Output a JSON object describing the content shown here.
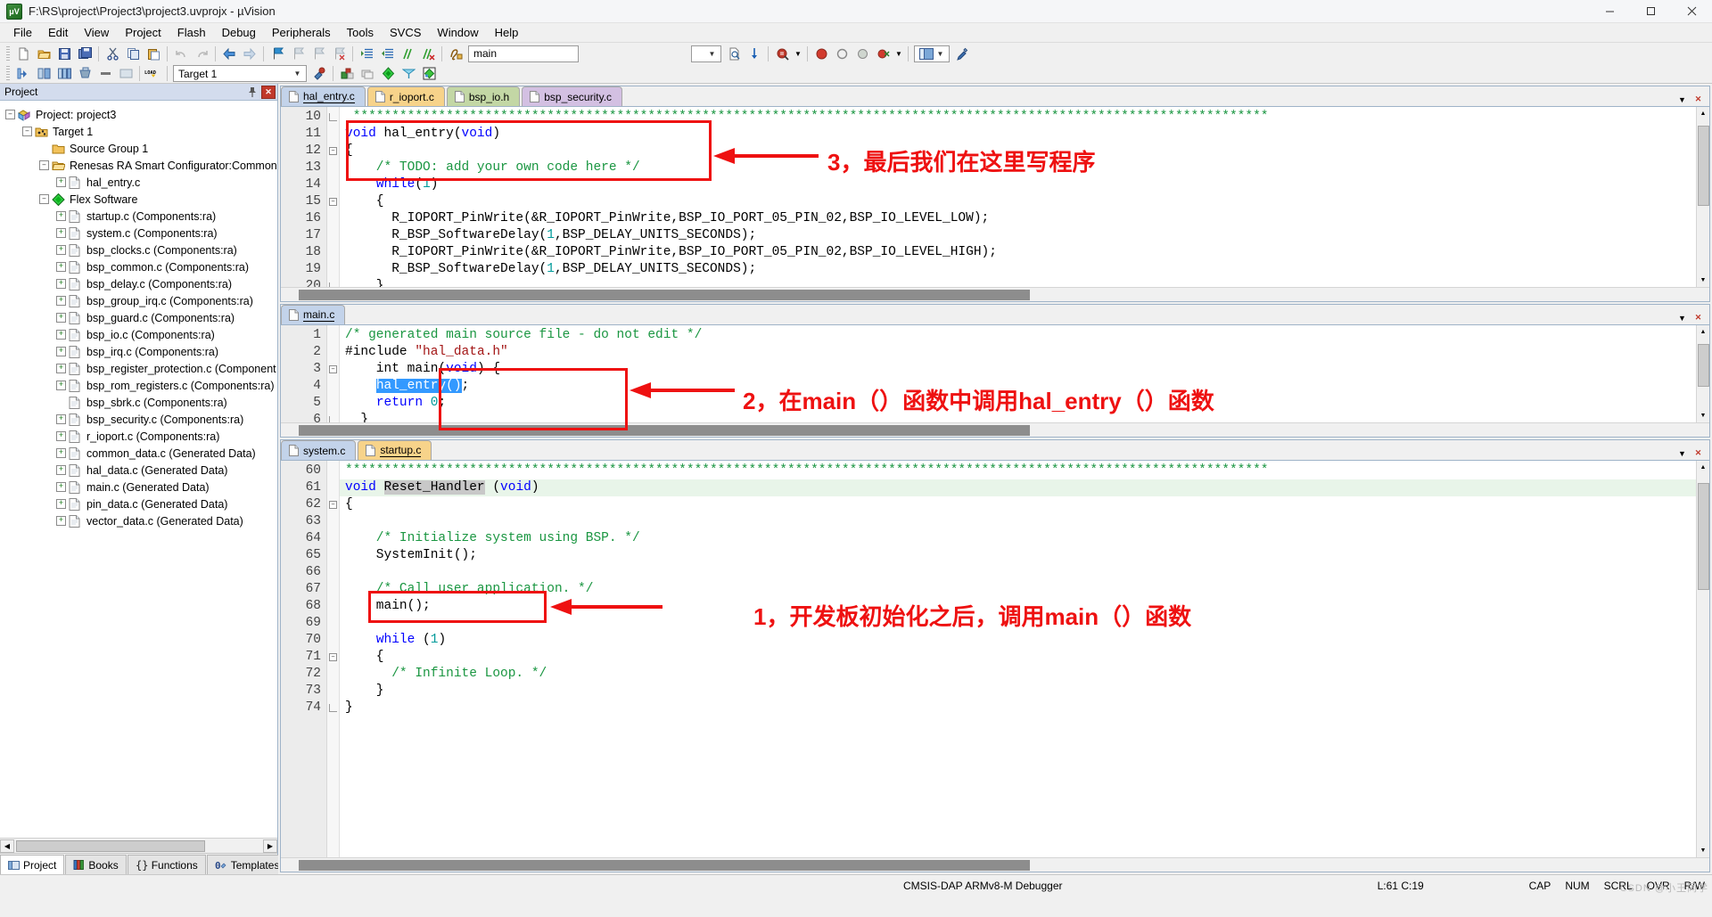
{
  "window": {
    "title": "F:\\RS\\project\\Project3\\project3.uvprojx - µVision",
    "app_icon": "uvision-icon",
    "minimize": "–",
    "maximize": "❐",
    "close": "✕"
  },
  "menu": [
    {
      "label": "File",
      "accel": "F"
    },
    {
      "label": "Edit",
      "accel": "E"
    },
    {
      "label": "View",
      "accel": "V"
    },
    {
      "label": "Project",
      "accel": "P"
    },
    {
      "label": "Flash",
      "accel": "a"
    },
    {
      "label": "Debug",
      "accel": "D"
    },
    {
      "label": "Peripherals",
      "accel": "i"
    },
    {
      "label": "Tools",
      "accel": "T"
    },
    {
      "label": "SVCS",
      "accel": "S"
    },
    {
      "label": "Window",
      "accel": "W"
    },
    {
      "label": "Help",
      "accel": "H"
    }
  ],
  "toolbar_main": {
    "function_combo_value": "main",
    "icons": [
      "new-file-icon",
      "open-file-icon",
      "save-icon",
      "save-all-icon",
      "cut-icon",
      "copy-icon",
      "paste-icon",
      "undo-icon",
      "redo-icon",
      "navigate-back-icon",
      "navigate-forward-icon",
      "bookmark-toggle-icon",
      "bookmark-prev-icon",
      "bookmark-next-icon",
      "bookmark-clear-icon",
      "indent-right-icon",
      "indent-left-icon",
      "comment-icon",
      "uncomment-icon",
      "insert-function-icon",
      "empty-combo",
      "file-find-icon",
      "spell-icon",
      "search-icon",
      "dropdown-arrow-icon",
      "stop-record-icon",
      "start-debug-icon",
      "breakpoint-icon",
      "disable-breakpoint-icon",
      "kill-breakpoints-icon",
      "dropdown-arrow2-icon",
      "window-layout-icon",
      "configure-icon"
    ]
  },
  "toolbar_build": {
    "target_combo_value": "Target 1",
    "icons": [
      "translate-icon",
      "build-icon",
      "rebuild-icon",
      "batch-build-icon",
      "stop-build-icon",
      "load-icon",
      "target-options-icon",
      "manage-runtime-icon",
      "packs-icon",
      "pack-installer-icon",
      "configure-flash-icon",
      "smart-configurator-icon",
      "rte-icon"
    ]
  },
  "project_panel": {
    "title": "Project",
    "pin_icon": "pin-icon",
    "close_icon": "close-icon",
    "tree": [
      {
        "label": "Project: project3",
        "depth": 0,
        "toggle": "minus",
        "icon": "project-icon"
      },
      {
        "label": "Target 1",
        "depth": 1,
        "toggle": "minus",
        "icon": "target-icon"
      },
      {
        "label": "Source Group 1",
        "depth": 2,
        "toggle": "none",
        "icon": "folder-icon"
      },
      {
        "label": "Renesas RA Smart Configurator:Common",
        "depth": 2,
        "toggle": "minus",
        "icon": "folder-open-icon"
      },
      {
        "label": "hal_entry.c",
        "depth": 3,
        "toggle": "plus",
        "icon": "c-file-icon"
      },
      {
        "label": "Flex Software",
        "depth": 2,
        "toggle": "minus",
        "icon": "component-icon"
      },
      {
        "label": "startup.c (Components:ra)",
        "depth": 3,
        "toggle": "plus",
        "icon": "c-file-icon"
      },
      {
        "label": "system.c (Components:ra)",
        "depth": 3,
        "toggle": "plus",
        "icon": "c-file-icon"
      },
      {
        "label": "bsp_clocks.c (Components:ra)",
        "depth": 3,
        "toggle": "plus",
        "icon": "c-file-icon"
      },
      {
        "label": "bsp_common.c (Components:ra)",
        "depth": 3,
        "toggle": "plus",
        "icon": "c-file-icon"
      },
      {
        "label": "bsp_delay.c (Components:ra)",
        "depth": 3,
        "toggle": "plus",
        "icon": "c-file-icon"
      },
      {
        "label": "bsp_group_irq.c (Components:ra)",
        "depth": 3,
        "toggle": "plus",
        "icon": "c-file-icon"
      },
      {
        "label": "bsp_guard.c (Components:ra)",
        "depth": 3,
        "toggle": "plus",
        "icon": "c-file-icon"
      },
      {
        "label": "bsp_io.c (Components:ra)",
        "depth": 3,
        "toggle": "plus",
        "icon": "c-file-icon"
      },
      {
        "label": "bsp_irq.c (Components:ra)",
        "depth": 3,
        "toggle": "plus",
        "icon": "c-file-icon"
      },
      {
        "label": "bsp_register_protection.c (Component",
        "depth": 3,
        "toggle": "plus",
        "icon": "c-file-icon"
      },
      {
        "label": "bsp_rom_registers.c (Components:ra)",
        "depth": 3,
        "toggle": "plus",
        "icon": "c-file-icon"
      },
      {
        "label": "bsp_sbrk.c (Components:ra)",
        "depth": 3,
        "toggle": "none",
        "icon": "c-file-icon"
      },
      {
        "label": "bsp_security.c (Components:ra)",
        "depth": 3,
        "toggle": "plus",
        "icon": "c-file-icon"
      },
      {
        "label": "r_ioport.c (Components:ra)",
        "depth": 3,
        "toggle": "plus",
        "icon": "c-file-icon"
      },
      {
        "label": "common_data.c (Generated Data)",
        "depth": 3,
        "toggle": "plus",
        "icon": "c-file-icon"
      },
      {
        "label": "hal_data.c (Generated Data)",
        "depth": 3,
        "toggle": "plus",
        "icon": "c-file-icon"
      },
      {
        "label": "main.c (Generated Data)",
        "depth": 3,
        "toggle": "plus",
        "icon": "c-file-icon"
      },
      {
        "label": "pin_data.c (Generated Data)",
        "depth": 3,
        "toggle": "plus",
        "icon": "c-file-icon"
      },
      {
        "label": "vector_data.c (Generated Data)",
        "depth": 3,
        "toggle": "plus",
        "icon": "c-file-icon"
      }
    ],
    "bottom_tabs": [
      {
        "label": "Project",
        "icon": "project-tab-icon",
        "active": true
      },
      {
        "label": "Books",
        "icon": "books-icon",
        "active": false
      },
      {
        "label": "Functions",
        "icon": "functions-icon",
        "active": false
      },
      {
        "label": "Templates",
        "icon": "templates-icon",
        "active": false
      }
    ]
  },
  "editors": [
    {
      "id": "editor-top",
      "tabs": [
        {
          "label": "hal_entry.c",
          "color": "#c3d3ea",
          "active": true
        },
        {
          "label": "r_ioport.c",
          "color": "#f7d38a",
          "active": false
        },
        {
          "label": "bsp_io.h",
          "color": "#c3d7a5",
          "active": false
        },
        {
          "label": "bsp_security.c",
          "color": "#d3c0e2",
          "active": false
        }
      ],
      "first_line": 10,
      "lines": [
        {
          "n": 10,
          "fold": "end",
          "tokens": [
            {
              "t": " **********************************************************************************************************************",
              "c": "cm"
            }
          ]
        },
        {
          "n": 11,
          "fold": "",
          "tokens": [
            {
              "t": "void",
              "c": "kw"
            },
            {
              "t": " hal_entry",
              "c": ""
            },
            {
              "t": "(",
              "c": ""
            },
            {
              "t": "void",
              "c": "kw"
            },
            {
              "t": ")",
              "c": ""
            }
          ]
        },
        {
          "n": 12,
          "fold": "minus",
          "tokens": [
            {
              "t": "{",
              "c": ""
            }
          ]
        },
        {
          "n": 13,
          "fold": "",
          "tokens": [
            {
              "t": "    /* TODO: add your own code here */",
              "c": "cm"
            }
          ]
        },
        {
          "n": 14,
          "fold": "",
          "tokens": [
            {
              "t": "    ",
              "c": ""
            },
            {
              "t": "while",
              "c": "kw"
            },
            {
              "t": "(",
              "c": ""
            },
            {
              "t": "1",
              "c": "num"
            },
            {
              "t": ")",
              "c": ""
            }
          ]
        },
        {
          "n": 15,
          "fold": "minus",
          "tokens": [
            {
              "t": "    {",
              "c": ""
            }
          ]
        },
        {
          "n": 16,
          "fold": "",
          "tokens": [
            {
              "t": "      R_IOPORT_PinWrite(&R_IOPORT_PinWrite,BSP_IO_PORT_05_PIN_02,BSP_IO_LEVEL_LOW);",
              "c": ""
            }
          ]
        },
        {
          "n": 17,
          "fold": "",
          "tokens": [
            {
              "t": "      R_BSP_SoftwareDelay(",
              "c": ""
            },
            {
              "t": "1",
              "c": "num"
            },
            {
              "t": ",BSP_DELAY_UNITS_SECONDS);",
              "c": ""
            }
          ]
        },
        {
          "n": 18,
          "fold": "",
          "tokens": [
            {
              "t": "      R_IOPORT_PinWrite(&R_IOPORT_PinWrite,BSP_IO_PORT_05_PIN_02,BSP_IO_LEVEL_HIGH);",
              "c": ""
            }
          ]
        },
        {
          "n": 19,
          "fold": "",
          "tokens": [
            {
              "t": "      R_BSP_SoftwareDelay(",
              "c": ""
            },
            {
              "t": "1",
              "c": "num"
            },
            {
              "t": ",BSP_DELAY_UNITS_SECONDS);",
              "c": ""
            }
          ]
        },
        {
          "n": 20,
          "fold": "end",
          "tokens": [
            {
              "t": "    }",
              "c": ""
            }
          ]
        }
      ]
    },
    {
      "id": "editor-middle",
      "tabs": [
        {
          "label": "main.c",
          "color": "#c3d3ea",
          "active": true
        }
      ],
      "first_line": 1,
      "lines": [
        {
          "n": 1,
          "fold": "",
          "tokens": [
            {
              "t": "/* generated main source file - do not edit */",
              "c": "cm"
            }
          ]
        },
        {
          "n": 2,
          "fold": "",
          "tokens": [
            {
              "t": "#include ",
              "c": ""
            },
            {
              "t": "\"hal_data.h\"",
              "c": "str"
            }
          ]
        },
        {
          "n": 3,
          "fold": "minus",
          "tokens": [
            {
              "t": "    int main(",
              "c": ""
            },
            {
              "t": "void",
              "c": "kw"
            },
            {
              "t": ") {",
              "c": ""
            }
          ]
        },
        {
          "n": 4,
          "fold": "",
          "tokens": [
            {
              "t": "    ",
              "c": ""
            },
            {
              "t": "hal_entry()",
              "c": "sel"
            },
            {
              "t": ";",
              "c": ""
            }
          ]
        },
        {
          "n": 5,
          "fold": "",
          "tokens": [
            {
              "t": "    ",
              "c": ""
            },
            {
              "t": "return",
              "c": "kw"
            },
            {
              "t": " ",
              "c": ""
            },
            {
              "t": "0",
              "c": "num"
            },
            {
              "t": ";",
              "c": ""
            }
          ]
        },
        {
          "n": 6,
          "fold": "end",
          "tokens": [
            {
              "t": "  }",
              "c": ""
            }
          ]
        }
      ]
    },
    {
      "id": "editor-bottom",
      "tabs": [
        {
          "label": "system.c",
          "color": "#c3d3ea",
          "active": false
        },
        {
          "label": "startup.c",
          "color": "#f7d38a",
          "active": true
        }
      ],
      "first_line": 60,
      "lines": [
        {
          "n": 60,
          "fold": "",
          "tokens": [
            {
              "t": "***********************************************************************************************************************",
              "c": "cm"
            }
          ]
        },
        {
          "n": 61,
          "fold": "",
          "hl": true,
          "tokens": [
            {
              "t": "void ",
              "c": "kw"
            },
            {
              "t": "Reset_Handler",
              "c": "selgray"
            },
            {
              "t": " (",
              "c": ""
            },
            {
              "t": "void",
              "c": "kw"
            },
            {
              "t": ")",
              "c": ""
            }
          ]
        },
        {
          "n": 62,
          "fold": "minus",
          "tokens": [
            {
              "t": "{",
              "c": ""
            }
          ]
        },
        {
          "n": 63,
          "fold": "",
          "tokens": [
            {
              "t": "",
              "c": ""
            }
          ]
        },
        {
          "n": 64,
          "fold": "",
          "tokens": [
            {
              "t": "    /* Initialize system using BSP. */",
              "c": "cm"
            }
          ]
        },
        {
          "n": 65,
          "fold": "",
          "tokens": [
            {
              "t": "    SystemInit();",
              "c": ""
            }
          ]
        },
        {
          "n": 66,
          "fold": "",
          "tokens": [
            {
              "t": "",
              "c": ""
            }
          ]
        },
        {
          "n": 67,
          "fold": "",
          "tokens": [
            {
              "t": "    /* Call user application. */",
              "c": "cm"
            }
          ]
        },
        {
          "n": 68,
          "fold": "",
          "tokens": [
            {
              "t": "    main();",
              "c": ""
            }
          ]
        },
        {
          "n": 69,
          "fold": "",
          "tokens": [
            {
              "t": "",
              "c": ""
            }
          ]
        },
        {
          "n": 70,
          "fold": "",
          "tokens": [
            {
              "t": "    ",
              "c": ""
            },
            {
              "t": "while",
              "c": "kw"
            },
            {
              "t": " (",
              "c": ""
            },
            {
              "t": "1",
              "c": "num"
            },
            {
              "t": ")",
              "c": ""
            }
          ]
        },
        {
          "n": 71,
          "fold": "minus",
          "tokens": [
            {
              "t": "    {",
              "c": ""
            }
          ]
        },
        {
          "n": 72,
          "fold": "",
          "tokens": [
            {
              "t": "      /* Infinite Loop. */",
              "c": "cm"
            }
          ]
        },
        {
          "n": 73,
          "fold": "",
          "tokens": [
            {
              "t": "    }",
              "c": ""
            }
          ]
        },
        {
          "n": 74,
          "fold": "end",
          "tokens": [
            {
              "t": "}",
              "c": ""
            }
          ]
        }
      ]
    }
  ],
  "annotations": [
    {
      "id": "anno-3",
      "text": "3，最后我们在这里写程序",
      "color": "#ee1111"
    },
    {
      "id": "anno-2",
      "text": "2，在main（）函数中调用hal_entry（）函数",
      "color": "#ee1111"
    },
    {
      "id": "anno-1",
      "text": "1，开发板初始化之后，调用main（）函数",
      "color": "#ee1111"
    }
  ],
  "statusbar": {
    "debugger": "CMSIS-DAP ARMv8-M Debugger",
    "position": "L:61 C:19",
    "cap": "CAP",
    "num": "NUM",
    "scrl": "SCRL",
    "ovr": "OVR",
    "rw": "R/W",
    "watermark": "CSDN @小王同学"
  }
}
